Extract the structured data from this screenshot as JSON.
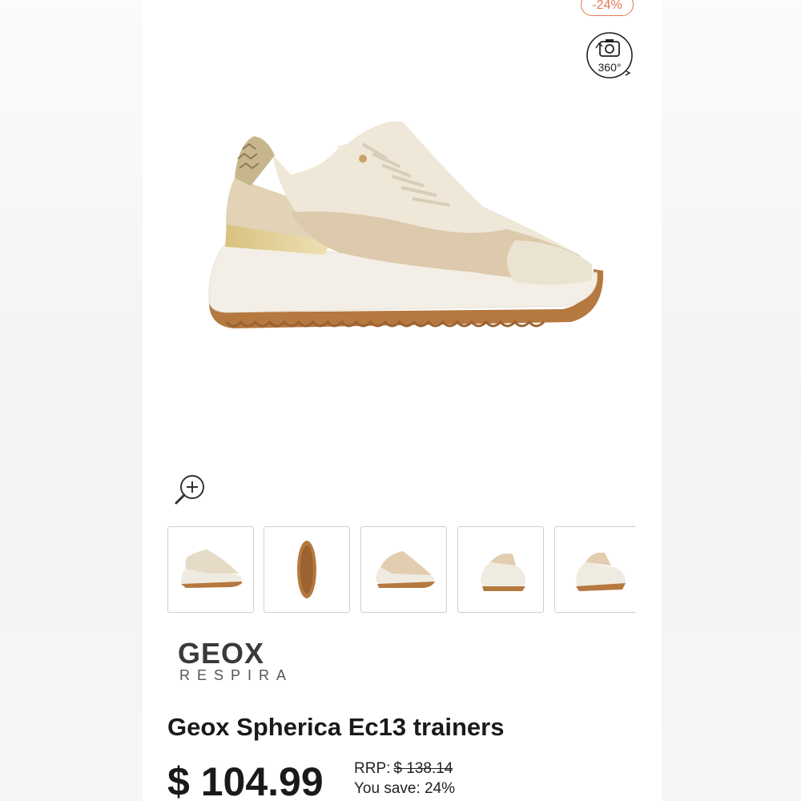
{
  "badge": {
    "discount": "-24%"
  },
  "view360": {
    "label": "360°"
  },
  "thumbnails": [
    {
      "name": "thumb-side-view"
    },
    {
      "name": "thumb-sole-view"
    },
    {
      "name": "thumb-inner-side-view"
    },
    {
      "name": "thumb-front-angle-view"
    },
    {
      "name": "thumb-back-angle-view"
    }
  ],
  "brand": {
    "name": "GEOX",
    "sub": "RESPIRA"
  },
  "product": {
    "title": "Geox Spherica Ec13 trainers",
    "price": "$ 104.99",
    "rrp_label": "RRP:",
    "rrp_value": "$ 138.14",
    "save_label": "You save: 24%"
  },
  "colors": {
    "accent": "#e07a4f",
    "sole_gum": "#b5783f",
    "upper_cream": "#efe7d8",
    "suede_beige": "#ddc9ab"
  }
}
